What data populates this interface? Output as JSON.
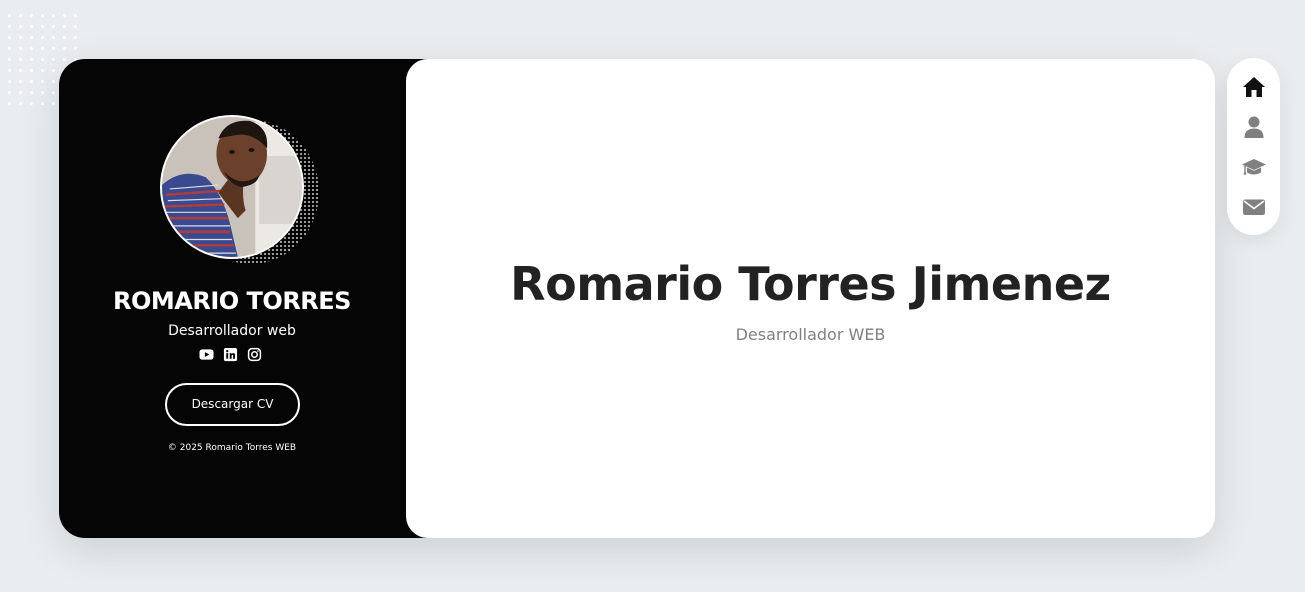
{
  "profile": {
    "name": "ROMARIO TORRES",
    "role": "Desarrollador web",
    "socials": [
      {
        "icon": "youtube-icon"
      },
      {
        "icon": "linkedin-icon"
      },
      {
        "icon": "instagram-icon"
      }
    ],
    "cv_button": "Descargar CV",
    "copyright": "© 2025 Romario Torres WEB"
  },
  "main": {
    "title": "Romario Torres Jimenez",
    "subtitle": "Desarrollador WEB"
  },
  "nav": {
    "items": [
      {
        "icon": "home-icon",
        "active": true
      },
      {
        "icon": "user-icon",
        "active": false
      },
      {
        "icon": "graduation-cap-icon",
        "active": false
      },
      {
        "icon": "envelope-icon",
        "active": false
      }
    ]
  },
  "colors": {
    "profile_bg": "#050505",
    "page_bg": "#e9edf0",
    "nav_active": "#111111",
    "nav_inactive": "#808080",
    "subtitle": "#808080"
  }
}
